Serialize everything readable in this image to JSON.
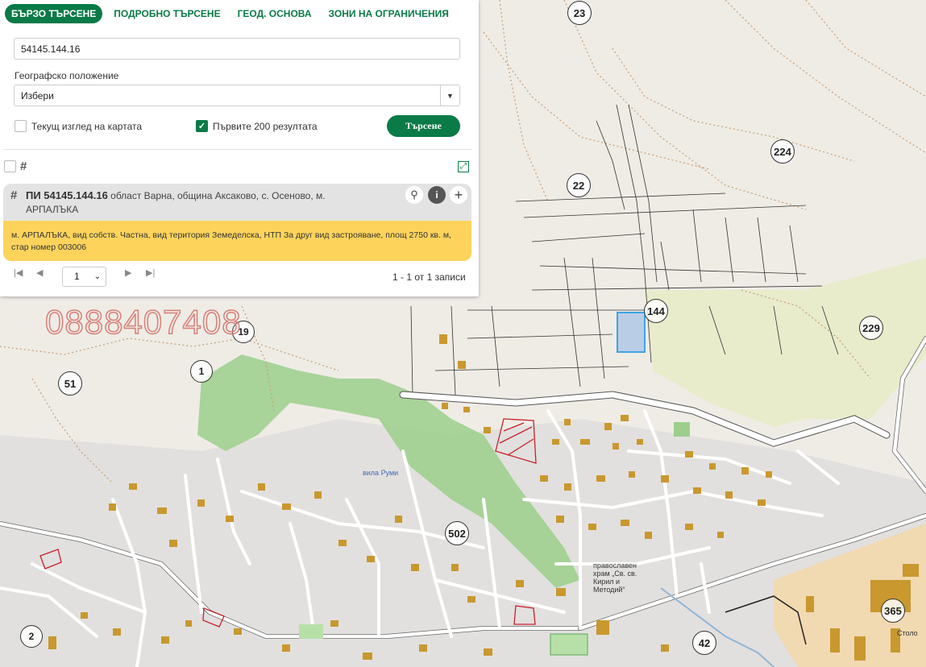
{
  "tabs": [
    {
      "label": "БЪРЗО ТЪРСЕНЕ"
    },
    {
      "label": "ПОДРОБНО ТЪРСЕНЕ"
    },
    {
      "label": "ГЕОД. ОСНОВА"
    },
    {
      "label": "ЗОНИ НА ОГРАНИЧЕНИЯ"
    }
  ],
  "search": {
    "query_value": "54145.144.16",
    "geo_label": "Географско положение",
    "geo_selected": "Избери",
    "current_view_label": "Текущ изглед на картата",
    "current_view_checked": false,
    "first200_label": "Първите 200 резултата",
    "first200_checked": true,
    "button_label": "Търсене"
  },
  "result": {
    "id_label": "ПИ 54145.144.16",
    "location": "област Варна, община Аксаково, с. Осеново, м. АРПАЛЪКА",
    "details": "м. АРПАЛЪКА, вид собств. Частна, вид територия Земеделска, НТП За друг вид застрояване, площ 2750 кв. м, стар номер 003006"
  },
  "pagination": {
    "page": "1",
    "summary": "1 - 1 от 1 записи"
  },
  "map": {
    "watermark": "0888407408",
    "region_labels": [
      "23",
      "224",
      "22",
      "144",
      "229",
      "19",
      "1",
      "51",
      "502",
      "2",
      "42",
      "365"
    ],
    "place_texts": [
      "вила Руми",
      "православен храм „Св. св. Кирил и Методий“",
      "Столо"
    ],
    "colors": {
      "highlight_parcel": "#b9cde6",
      "forest": "#9bcf8b",
      "agri": "#e8eccb",
      "buildings": "#c9982e",
      "accent_green": "#0a7a47"
    }
  }
}
